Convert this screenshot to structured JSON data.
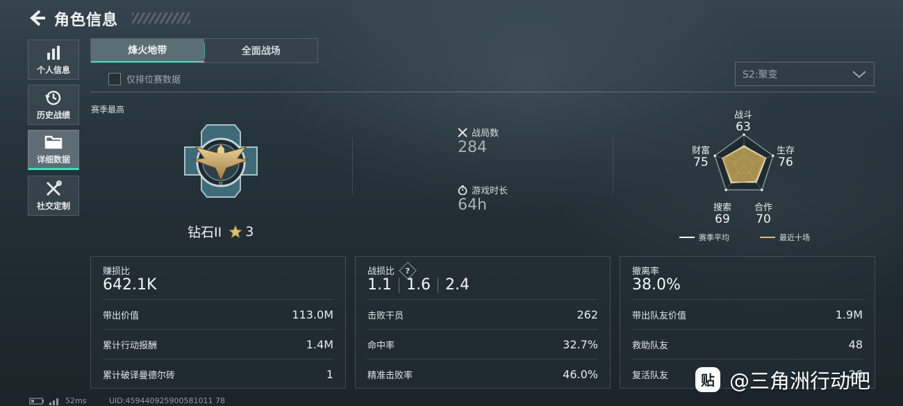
{
  "header": {
    "title": "角色信息"
  },
  "nav": {
    "items": [
      {
        "label": "个人信息",
        "icon": "bar-chart-icon"
      },
      {
        "label": "历史战绩",
        "icon": "history-icon"
      },
      {
        "label": "详细数据",
        "icon": "folder-icon",
        "active": true
      },
      {
        "label": "社交定制",
        "icon": "tools-icon"
      }
    ]
  },
  "tabs": [
    {
      "label": "烽火地带",
      "active": true
    },
    {
      "label": "全面战场",
      "active": false
    }
  ],
  "filter": {
    "rank_only_label": "仅排位赛数据",
    "checked": false
  },
  "season_select": {
    "value": "S2:聚变"
  },
  "season_best": {
    "label": "赛季最高",
    "rank_name": "钻石II",
    "stars": "3"
  },
  "summary": {
    "matches_label": "战局数",
    "matches_value": "284",
    "time_label": "游戏时长",
    "time_value": "64h"
  },
  "radar": {
    "axes": [
      {
        "label": "战斗",
        "value": "63"
      },
      {
        "label": "生存",
        "value": "76"
      },
      {
        "label": "合作",
        "value": "70"
      },
      {
        "label": "搜索",
        "value": "69"
      },
      {
        "label": "财富",
        "value": "75"
      }
    ],
    "season_values": [
      63,
      76,
      70,
      69,
      75
    ],
    "recent_values": [
      60,
      74,
      65,
      72,
      74
    ],
    "max": 100,
    "legend": [
      {
        "label": "赛季平均",
        "color": "#ffffff"
      },
      {
        "label": "最近十场",
        "color": "#d9c27a"
      }
    ],
    "fill_color": "#c9a95a"
  },
  "cards": {
    "profit": {
      "title": "赚损比",
      "value": "642.1K",
      "rows": [
        {
          "label": "带出价值",
          "value": "113.0M"
        },
        {
          "label": "累计行动报酬",
          "value": "1.4M"
        },
        {
          "label": "累计破译曼德尔砖",
          "value": "1"
        }
      ]
    },
    "kd": {
      "title": "战损比",
      "help": "?",
      "values": [
        "1.1",
        "1.6",
        "2.4"
      ],
      "rows": [
        {
          "label": "击败干员",
          "value": "262"
        },
        {
          "label": "命中率",
          "value": "32.7%"
        },
        {
          "label": "精准击败率",
          "value": "46.0%"
        }
      ]
    },
    "extract": {
      "title": "撤离率",
      "value": "38.0%",
      "rows": [
        {
          "label": "带出队友价值",
          "value": "1.9M"
        },
        {
          "label": "救助队友",
          "value": "48"
        },
        {
          "label": "复活队友",
          "value": "26"
        }
      ]
    }
  },
  "footer": {
    "ping": "52ms",
    "uid": "UID:459440925900581011 78"
  },
  "watermark": {
    "text": "@三角洲行动吧",
    "icon": "tieba-logo-icon"
  },
  "colors": {
    "accent": "#3fe0b5",
    "gold": "#d9c27a"
  }
}
